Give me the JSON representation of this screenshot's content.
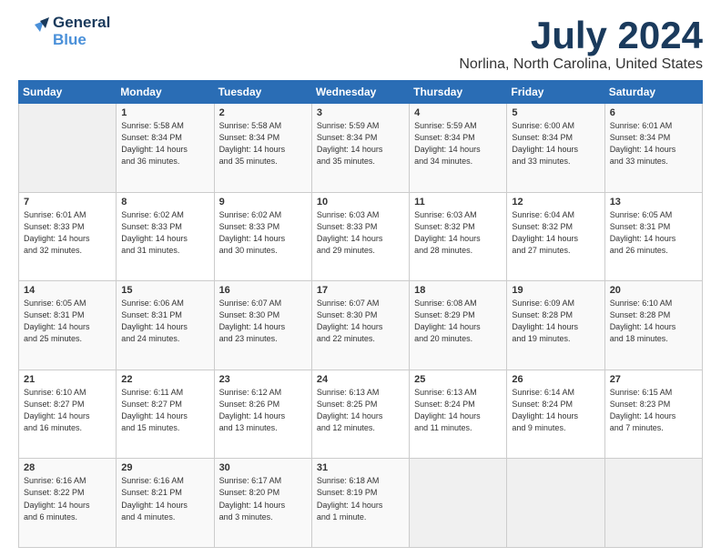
{
  "logo": {
    "line1": "General",
    "line2": "Blue"
  },
  "title": "July 2024",
  "subtitle": "Norlina, North Carolina, United States",
  "days_of_week": [
    "Sunday",
    "Monday",
    "Tuesday",
    "Wednesday",
    "Thursday",
    "Friday",
    "Saturday"
  ],
  "weeks": [
    [
      {
        "day": "",
        "info": ""
      },
      {
        "day": "1",
        "info": "Sunrise: 5:58 AM\nSunset: 8:34 PM\nDaylight: 14 hours\nand 36 minutes."
      },
      {
        "day": "2",
        "info": "Sunrise: 5:58 AM\nSunset: 8:34 PM\nDaylight: 14 hours\nand 35 minutes."
      },
      {
        "day": "3",
        "info": "Sunrise: 5:59 AM\nSunset: 8:34 PM\nDaylight: 14 hours\nand 35 minutes."
      },
      {
        "day": "4",
        "info": "Sunrise: 5:59 AM\nSunset: 8:34 PM\nDaylight: 14 hours\nand 34 minutes."
      },
      {
        "day": "5",
        "info": "Sunrise: 6:00 AM\nSunset: 8:34 PM\nDaylight: 14 hours\nand 33 minutes."
      },
      {
        "day": "6",
        "info": "Sunrise: 6:01 AM\nSunset: 8:34 PM\nDaylight: 14 hours\nand 33 minutes."
      }
    ],
    [
      {
        "day": "7",
        "info": "Sunrise: 6:01 AM\nSunset: 8:33 PM\nDaylight: 14 hours\nand 32 minutes."
      },
      {
        "day": "8",
        "info": "Sunrise: 6:02 AM\nSunset: 8:33 PM\nDaylight: 14 hours\nand 31 minutes."
      },
      {
        "day": "9",
        "info": "Sunrise: 6:02 AM\nSunset: 8:33 PM\nDaylight: 14 hours\nand 30 minutes."
      },
      {
        "day": "10",
        "info": "Sunrise: 6:03 AM\nSunset: 8:33 PM\nDaylight: 14 hours\nand 29 minutes."
      },
      {
        "day": "11",
        "info": "Sunrise: 6:03 AM\nSunset: 8:32 PM\nDaylight: 14 hours\nand 28 minutes."
      },
      {
        "day": "12",
        "info": "Sunrise: 6:04 AM\nSunset: 8:32 PM\nDaylight: 14 hours\nand 27 minutes."
      },
      {
        "day": "13",
        "info": "Sunrise: 6:05 AM\nSunset: 8:31 PM\nDaylight: 14 hours\nand 26 minutes."
      }
    ],
    [
      {
        "day": "14",
        "info": "Sunrise: 6:05 AM\nSunset: 8:31 PM\nDaylight: 14 hours\nand 25 minutes."
      },
      {
        "day": "15",
        "info": "Sunrise: 6:06 AM\nSunset: 8:31 PM\nDaylight: 14 hours\nand 24 minutes."
      },
      {
        "day": "16",
        "info": "Sunrise: 6:07 AM\nSunset: 8:30 PM\nDaylight: 14 hours\nand 23 minutes."
      },
      {
        "day": "17",
        "info": "Sunrise: 6:07 AM\nSunset: 8:30 PM\nDaylight: 14 hours\nand 22 minutes."
      },
      {
        "day": "18",
        "info": "Sunrise: 6:08 AM\nSunset: 8:29 PM\nDaylight: 14 hours\nand 20 minutes."
      },
      {
        "day": "19",
        "info": "Sunrise: 6:09 AM\nSunset: 8:28 PM\nDaylight: 14 hours\nand 19 minutes."
      },
      {
        "day": "20",
        "info": "Sunrise: 6:10 AM\nSunset: 8:28 PM\nDaylight: 14 hours\nand 18 minutes."
      }
    ],
    [
      {
        "day": "21",
        "info": "Sunrise: 6:10 AM\nSunset: 8:27 PM\nDaylight: 14 hours\nand 16 minutes."
      },
      {
        "day": "22",
        "info": "Sunrise: 6:11 AM\nSunset: 8:27 PM\nDaylight: 14 hours\nand 15 minutes."
      },
      {
        "day": "23",
        "info": "Sunrise: 6:12 AM\nSunset: 8:26 PM\nDaylight: 14 hours\nand 13 minutes."
      },
      {
        "day": "24",
        "info": "Sunrise: 6:13 AM\nSunset: 8:25 PM\nDaylight: 14 hours\nand 12 minutes."
      },
      {
        "day": "25",
        "info": "Sunrise: 6:13 AM\nSunset: 8:24 PM\nDaylight: 14 hours\nand 11 minutes."
      },
      {
        "day": "26",
        "info": "Sunrise: 6:14 AM\nSunset: 8:24 PM\nDaylight: 14 hours\nand 9 minutes."
      },
      {
        "day": "27",
        "info": "Sunrise: 6:15 AM\nSunset: 8:23 PM\nDaylight: 14 hours\nand 7 minutes."
      }
    ],
    [
      {
        "day": "28",
        "info": "Sunrise: 6:16 AM\nSunset: 8:22 PM\nDaylight: 14 hours\nand 6 minutes."
      },
      {
        "day": "29",
        "info": "Sunrise: 6:16 AM\nSunset: 8:21 PM\nDaylight: 14 hours\nand 4 minutes."
      },
      {
        "day": "30",
        "info": "Sunrise: 6:17 AM\nSunset: 8:20 PM\nDaylight: 14 hours\nand 3 minutes."
      },
      {
        "day": "31",
        "info": "Sunrise: 6:18 AM\nSunset: 8:19 PM\nDaylight: 14 hours\nand 1 minute."
      },
      {
        "day": "",
        "info": ""
      },
      {
        "day": "",
        "info": ""
      },
      {
        "day": "",
        "info": ""
      }
    ]
  ]
}
